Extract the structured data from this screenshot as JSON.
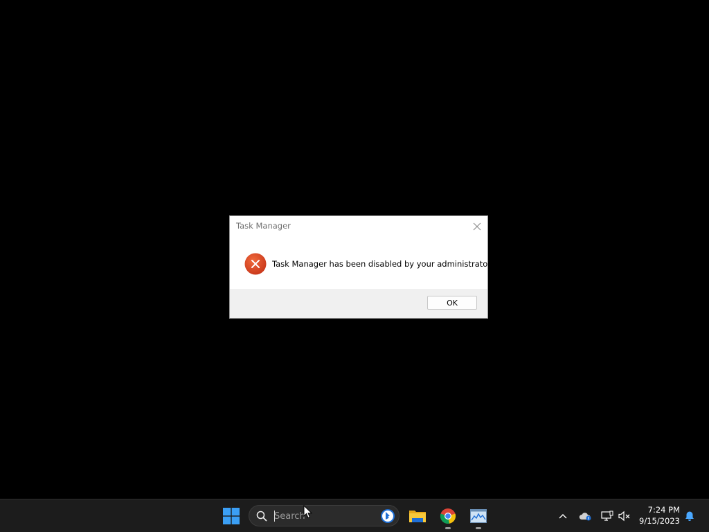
{
  "dialog": {
    "title": "Task Manager",
    "message": "Task Manager has been disabled by your administrator.",
    "ok_label": "OK",
    "icon": "error-icon"
  },
  "taskbar": {
    "search": {
      "placeholder": "Search",
      "value": ""
    },
    "apps": [
      {
        "name": "Start",
        "icon": "windows-start-icon"
      },
      {
        "name": "File Explorer",
        "icon": "folder-icon"
      },
      {
        "name": "Google Chrome",
        "icon": "chrome-icon"
      },
      {
        "name": "Task Manager",
        "icon": "task-manager-icon"
      }
    ],
    "tray": {
      "icons": [
        "chevron-up-icon",
        "onedrive-icon",
        "network-icon",
        "volume-muted-icon",
        "notification-bell-icon"
      ],
      "time": "7:24 PM",
      "date": "9/15/2023"
    }
  },
  "colors": {
    "desktop": "#000000",
    "taskbar": "#1c1c1c",
    "error_icon": "#d9431e",
    "dialog_footer": "#f0f0f0",
    "windows_blue": "#3b9ff5"
  }
}
